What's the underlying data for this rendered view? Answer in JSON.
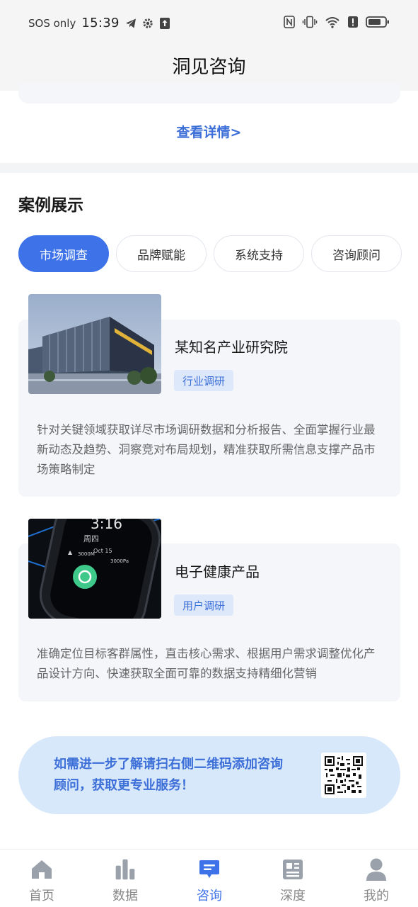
{
  "status_bar": {
    "carrier": "SOS only",
    "time": "15:39"
  },
  "header": {
    "title": "洞见咨询"
  },
  "details_link": "查看详情>",
  "cases_section": {
    "title": "案例展示",
    "tabs": [
      {
        "label": "市场调查",
        "active": true
      },
      {
        "label": "品牌赋能",
        "active": false
      },
      {
        "label": "系统支持",
        "active": false
      },
      {
        "label": "咨询顾问",
        "active": false
      }
    ],
    "items": [
      {
        "title": "某知名产业研究院",
        "tag": "行业调研",
        "description": "针对关键领域获取详尽市场调研数据和分析报告、全面掌握行业最新动态及趋势、洞察竞对布局规划，精准获取所需信息支撑产品市场策略制定"
      },
      {
        "title": "电子健康产品",
        "tag": "用户调研",
        "description": "准确定位目标客群属性，直击核心需求、根据用户需求调整优化产品设计方向、快速获取全面可靠的数据支持精细化营销",
        "watch_text": {
          "time": "3:16",
          "weekday": "周四",
          "date": "Oct  15",
          "altitude": "3000M",
          "pressure": "3000Pa"
        }
      }
    ]
  },
  "cta": {
    "text": "如需进一步了解请扫右侧二维码添加咨询顾问，获取更专业服务！"
  },
  "bottom_nav": [
    {
      "label": "首页",
      "icon": "home-icon",
      "active": false
    },
    {
      "label": "数据",
      "icon": "bar-chart-icon",
      "active": false
    },
    {
      "label": "咨询",
      "icon": "chat-bubble-icon",
      "active": true
    },
    {
      "label": "深度",
      "icon": "article-icon",
      "active": false
    },
    {
      "label": "我的",
      "icon": "user-icon",
      "active": false
    }
  ],
  "colors": {
    "accent": "#3d72e8",
    "link": "#3d6fd8",
    "tag_bg": "#dde9fb",
    "card_bg": "#f4f6f9",
    "cta_bg": "#d8e8fb"
  }
}
